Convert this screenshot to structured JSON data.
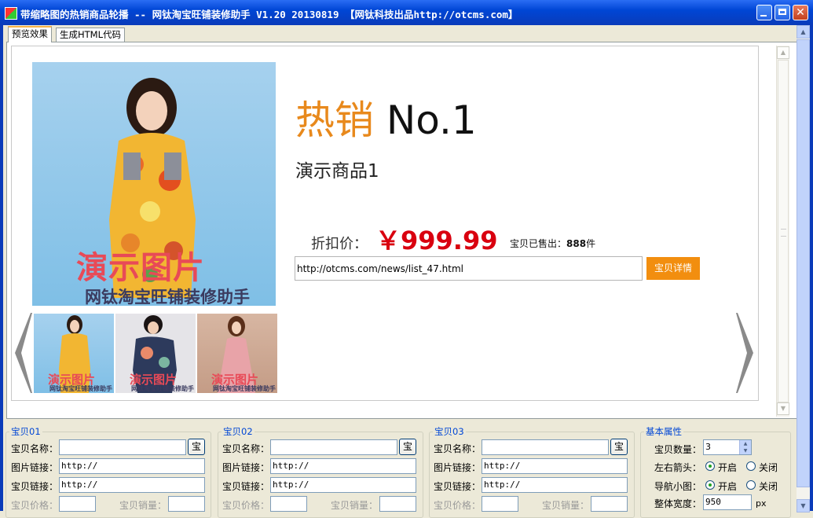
{
  "window": {
    "title": "带缩略图的热销商品轮播 -- 网钛淘宝旺铺装修助手 V1.20 20130819 【网钛科技出品http://otcms.com】"
  },
  "tabs": [
    {
      "label": "预览效果",
      "active": true
    },
    {
      "label": "生成HTML代码",
      "active": false
    }
  ],
  "preview": {
    "heading_hot": "热销",
    "heading_no": "No.1",
    "product_name": "演示商品1",
    "price_label": "折扣价：",
    "price": "￥999.99",
    "sold_label": "宝贝已售出：",
    "sold_count": "888",
    "sold_unit": "件",
    "url": "http://otcms.com/news/list_47.html",
    "detail_button": "宝贝详情",
    "watermark_big": "演示图片",
    "watermark_small": "网钛淘宝旺铺装修助手",
    "thumbnails": [
      {
        "wm_big": "演示图片",
        "wm_small": "网钛淘宝旺铺装修助手"
      },
      {
        "wm_big": "演示图片",
        "wm_small": "网钛淘宝旺铺装修助手"
      },
      {
        "wm_big": "演示图片",
        "wm_small": "网钛淘宝旺铺装修助手"
      }
    ]
  },
  "items": [
    {
      "title": "宝贝01",
      "name_label": "宝贝名称：",
      "name_value": "",
      "pick_button": "宝",
      "img_label": "图片链接：",
      "img_value": "http://",
      "link_label": "宝贝链接：",
      "link_value": "http://",
      "price_label": "宝贝价格：",
      "sales_label": "宝贝销量："
    },
    {
      "title": "宝贝02",
      "name_label": "宝贝名称：",
      "name_value": "",
      "pick_button": "宝",
      "img_label": "图片链接：",
      "img_value": "http://",
      "link_label": "宝贝链接：",
      "link_value": "http://",
      "price_label": "宝贝价格：",
      "sales_label": "宝贝销量："
    },
    {
      "title": "宝贝03",
      "name_label": "宝贝名称：",
      "name_value": "",
      "pick_button": "宝",
      "img_label": "图片链接：",
      "img_value": "http://",
      "link_label": "宝贝链接：",
      "link_value": "http://",
      "price_label": "宝贝价格：",
      "sales_label": "宝贝销量："
    }
  ],
  "basic": {
    "title": "基本属性",
    "count_label": "宝贝数量：",
    "count_value": "3",
    "arrows_label": "左右箭头：",
    "nav_label": "导航小图：",
    "on_label": "开启",
    "off_label": "关闭",
    "width_label": "整体宽度：",
    "width_value": "950",
    "width_unit": "px"
  },
  "colors": {
    "accent_orange": "#e8891c",
    "price_red": "#d9000f",
    "button_orange": "#f28e0f",
    "titlebar_blue": "#0046d5"
  }
}
